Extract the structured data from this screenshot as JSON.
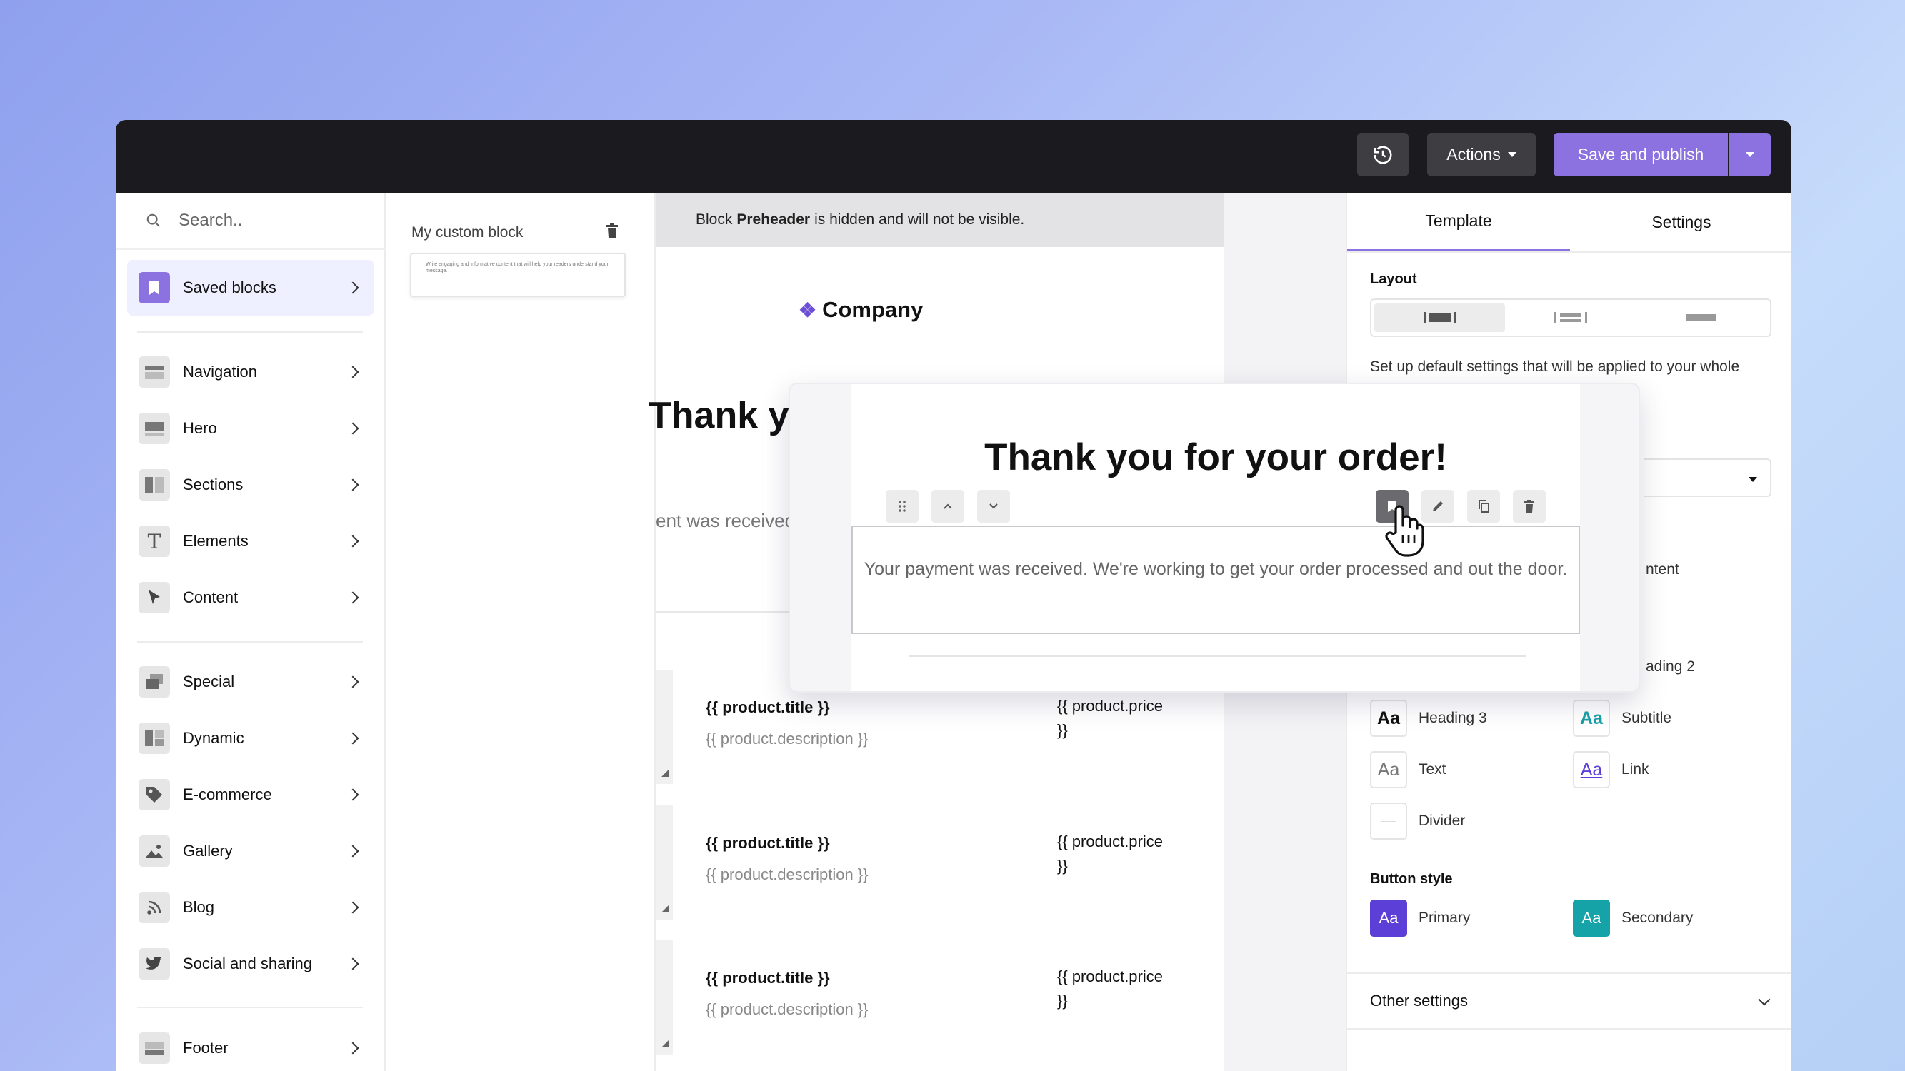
{
  "topbar": {
    "actions_label": "Actions",
    "save_label": "Save and publish"
  },
  "sidebar": {
    "search_placeholder": "Search..",
    "items": [
      {
        "label": "Saved blocks",
        "icon": "bookmark-icon"
      },
      {
        "label": "Navigation",
        "icon": "navigation-icon"
      },
      {
        "label": "Hero",
        "icon": "hero-icon"
      },
      {
        "label": "Sections",
        "icon": "sections-icon"
      },
      {
        "label": "Elements",
        "icon": "text-icon"
      },
      {
        "label": "Content",
        "icon": "cursor-icon"
      },
      {
        "label": "Special",
        "icon": "special-icon"
      },
      {
        "label": "Dynamic",
        "icon": "dynamic-icon"
      },
      {
        "label": "E-commerce",
        "icon": "tag-icon"
      },
      {
        "label": "Gallery",
        "icon": "image-icon"
      },
      {
        "label": "Blog",
        "icon": "rss-icon"
      },
      {
        "label": "Social and sharing",
        "icon": "twitter-icon"
      },
      {
        "label": "Footer",
        "icon": "footer-icon"
      }
    ]
  },
  "saved_blocks": {
    "title": "My custom block",
    "preview_text": "Write engaging and informative content that will help your readers understand your message."
  },
  "email": {
    "preheader_prefix": "Block",
    "preheader_bold": "Preheader",
    "preheader_suffix": "is hidden and will not be visible.",
    "company": "Company",
    "heading_partial": "Thank yo",
    "sub_partial": "ent was received",
    "products": [
      {
        "title": "{{ product.title }}",
        "description": "{{ product.description }}",
        "price": "{{ product.price }}"
      },
      {
        "title": "{{ product.title }}",
        "description": "{{ product.description }}",
        "price": "{{ product.price }}"
      },
      {
        "title": "{{ product.title }}",
        "description": "{{ product.description }}",
        "price": "{{ product.price }}"
      }
    ]
  },
  "preview": {
    "title": "Thank you for your order!",
    "text": "Your payment was received. We're working to get your order processed and out the door."
  },
  "panel": {
    "tabs": [
      "Template",
      "Settings"
    ],
    "layout_label": "Layout",
    "description": "Set up default settings that will be applied to your whole",
    "partial_content": "ntent",
    "partial_heading2": "ading 2",
    "text_styles": [
      {
        "sample": "Aa",
        "label": "Heading 3"
      },
      {
        "sample": "Aa",
        "label": "Subtitle"
      },
      {
        "sample": "Aa",
        "label": "Text"
      },
      {
        "sample": "Aa",
        "label": "Link"
      },
      {
        "sample": "",
        "label": "Divider"
      }
    ],
    "button_style_label": "Button style",
    "buttons": [
      {
        "sample": "Aa",
        "label": "Primary",
        "color": "#5b3fd6"
      },
      {
        "sample": "Aa",
        "label": "Secondary",
        "color": "#16a3a8"
      }
    ],
    "other_settings": "Other settings"
  },
  "colors": {
    "accent": "#8c72e0",
    "topbar": "#1b1b1f"
  }
}
